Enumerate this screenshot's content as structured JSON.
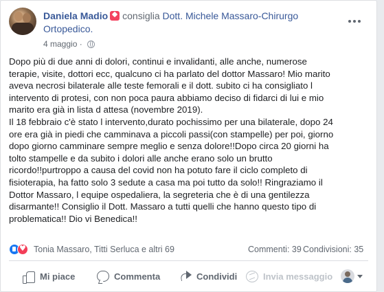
{
  "post": {
    "author": "Daniela Madio",
    "verb": "consiglia",
    "target_line1": "Dott. Michele Massaro-Chirurgo",
    "target_line2": "Ortopedico.",
    "date": "4 maggio",
    "body": "Dopo più di due anni di dolori, continui e invalidanti, alle anche, numerose\nterapie, visite, dottori ecc, qualcuno ci ha parlato del dottor Massaro! Mio marito\naveva necrosi bilaterale alle teste femorali e il dott. subito ci ha consigliato l\nintervento di protesi, con non poca paura abbiamo deciso di fidarci di lui e mio\nmarito era già in lista d attesa (novembre 2019).\nIl 18 febbraio c'è stato l intervento,durato pochissimo per una bilaterale, dopo 24\nore era già in piedi che camminava a piccoli passi(con stampelle) per poi, giorno\ndopo giorno camminare sempre meglio e senza dolore!!Dopo circa 20 giorni ha\ntolto stampelle e da subito i dolori alle anche erano solo un brutto\nricordo!!purtroppo a causa del covid non ha potuto fare il ciclo completo di\nfisioterapia, ha fatto solo 3 sedute a casa ma poi tutto da solo!! Ringraziamo il\nDottor Massaro, l equipe ospedaliera, la segreteria che è di una gentilezza\ndisarmante!! Consiglio il Dott. Massaro a tutti quelli che hanno questo tipo di\nproblematica!! Dio vi Benedica!!"
  },
  "reactions": {
    "people": "Tonia Massaro, Titti Serluca e altri 69",
    "comments": "Commenti: 39",
    "shares": "Condivisioni: 35"
  },
  "actions": {
    "like": "Mi piace",
    "comment": "Commenta",
    "share": "Condividi",
    "send": "Invia messaggio"
  },
  "colors": {
    "link": "#385898",
    "muted": "#606770",
    "recommend_badge": "#f3425f",
    "like_blue": "#1877f2",
    "love_red": "#f33e58"
  }
}
